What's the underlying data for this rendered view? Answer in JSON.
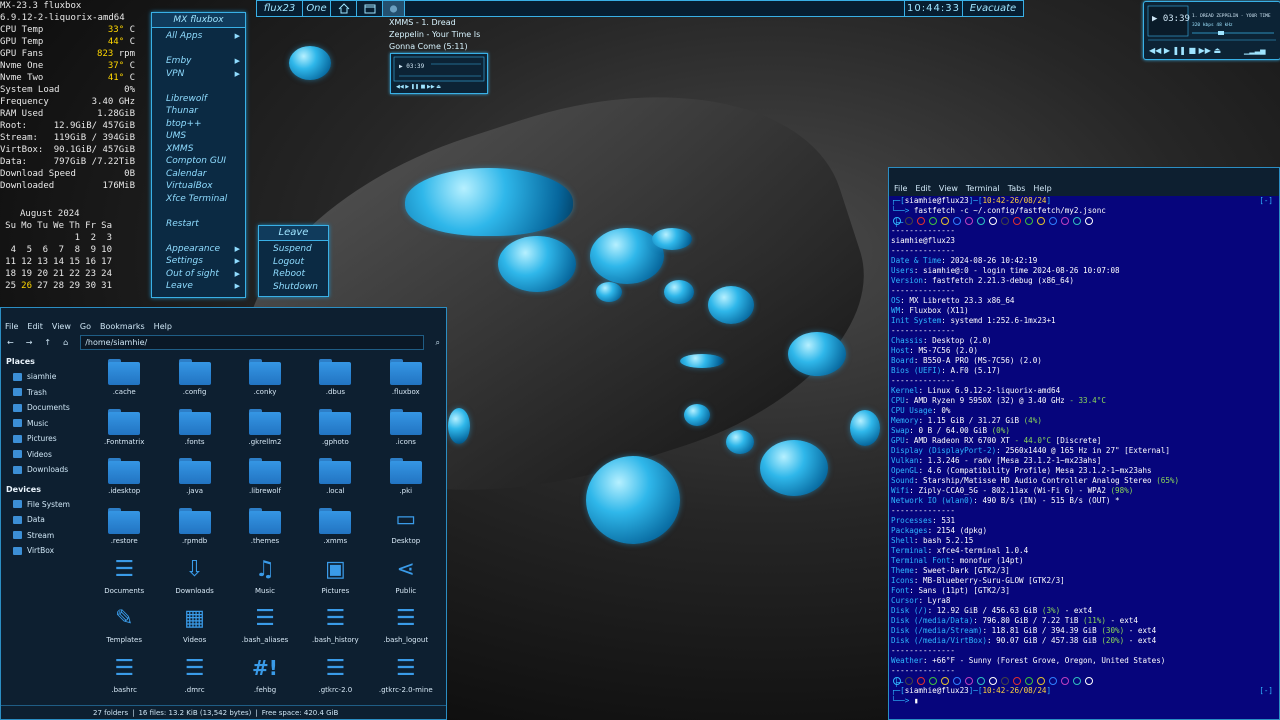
{
  "conky": {
    "title": "MX-23.3 fluxbox",
    "kernel": "6.9.12-2-liquorix-amd64",
    "rows": [
      {
        "label": "CPU Temp",
        "value": "33°",
        "unit": " C",
        "hl": true
      },
      {
        "label": "GPU Temp",
        "value": "44°",
        "unit": " C",
        "hl": true
      },
      {
        "label": "GPU Fans",
        "value": "823",
        "unit": " rpm",
        "hl": true
      },
      {
        "label": "Nvme One",
        "value": "37°",
        "unit": " C",
        "hl": true
      },
      {
        "label": "Nvme Two",
        "value": "41°",
        "unit": " C",
        "hl": true
      },
      {
        "label": "System Load",
        "value": "0%",
        "unit": "",
        "hl": false
      },
      {
        "label": "Frequency",
        "value": "3.40 GHz",
        "unit": "",
        "hl": false
      },
      {
        "label": "RAM Used",
        "value": "1.28GiB",
        "unit": "",
        "hl": false
      },
      {
        "label": "Root:",
        "value": "12.9GiB/ 457GiB",
        "unit": "",
        "hl": false
      },
      {
        "label": "Stream:",
        "value": "119GiB / 394GiB",
        "unit": "",
        "hl": false
      },
      {
        "label": "VirtBox:",
        "value": "90.1GiB/ 457GiB",
        "unit": "",
        "hl": false
      },
      {
        "label": "Data:",
        "value": "797GiB /7.22TiB",
        "unit": "",
        "hl": false
      },
      {
        "label": "Download Speed",
        "value": "0B",
        "unit": "",
        "hl": false
      },
      {
        "label": "Downloaded",
        "value": "176MiB",
        "unit": "",
        "hl": false
      }
    ],
    "calendar": {
      "month": "August 2024",
      "days_header": [
        "Su",
        "Mo",
        "Tu",
        "We",
        "Th",
        "Fr",
        "Sa"
      ],
      "weeks": [
        [
          "",
          "",
          "",
          "",
          "1",
          "2",
          "3"
        ],
        [
          "4",
          "5",
          "6",
          "7",
          "8",
          "9",
          "10"
        ],
        [
          "11",
          "12",
          "13",
          "14",
          "15",
          "16",
          "17"
        ],
        [
          "18",
          "19",
          "20",
          "21",
          "22",
          "23",
          "24"
        ],
        [
          "25",
          "26",
          "27",
          "28",
          "29",
          "30",
          "31"
        ]
      ],
      "today": "26"
    }
  },
  "fluxbox_menu": {
    "title": "MX fluxbox",
    "items": [
      {
        "label": "All Apps",
        "sub": true
      },
      {
        "sep": true
      },
      {
        "label": "Emby",
        "sub": true
      },
      {
        "label": "VPN",
        "sub": true
      },
      {
        "sep": true
      },
      {
        "label": "Librewolf"
      },
      {
        "label": "Thunar"
      },
      {
        "label": "btop++"
      },
      {
        "label": "UMS"
      },
      {
        "label": "XMMS"
      },
      {
        "label": "Compton GUI"
      },
      {
        "label": "Calendar"
      },
      {
        "label": "VirtualBox"
      },
      {
        "label": "Xfce Terminal"
      },
      {
        "sep": true
      },
      {
        "label": "Restart"
      },
      {
        "sep": true
      },
      {
        "label": "Appearance",
        "sub": true
      },
      {
        "label": "Settings",
        "sub": true
      },
      {
        "label": "Out of sight",
        "sub": true
      },
      {
        "label": "Leave",
        "sub": true
      }
    ]
  },
  "leave_menu": {
    "title": "Leave",
    "items": [
      "Suspend",
      "Logout",
      "Reboot",
      "Shutdown"
    ]
  },
  "toolbar": {
    "workspace_name": "flux23",
    "workspace": "One",
    "clock": "10:44:33",
    "right_button": "Evacuate"
  },
  "xmms_tooltip": "XMMS - 1. Dread Zeppelin - Your Time Is Gonna Come (5:11)",
  "xmms_player": {
    "time": "03:39",
    "title": "1. DREAD ZEPPELIN - YOUR TIME",
    "kbps": "320",
    "khz": "48"
  },
  "file_manager": {
    "menu": [
      "File",
      "Edit",
      "View",
      "Go",
      "Bookmarks",
      "Help"
    ],
    "path": "/home/siamhie/",
    "places_header": "Places",
    "places": [
      "siamhie",
      "Trash",
      "Documents",
      "Music",
      "Pictures",
      "Videos",
      "Downloads"
    ],
    "devices_header": "Devices",
    "devices": [
      "File System",
      "Data",
      "Stream",
      "VirtBox"
    ],
    "items": [
      {
        "name": ".cache",
        "type": "folder"
      },
      {
        "name": ".config",
        "type": "folder"
      },
      {
        "name": ".conky",
        "type": "folder"
      },
      {
        "name": ".dbus",
        "type": "folder"
      },
      {
        "name": ".fluxbox",
        "type": "folder"
      },
      {
        "name": ".Fontmatrix",
        "type": "folder"
      },
      {
        "name": ".fonts",
        "type": "folder"
      },
      {
        "name": ".gkrellm2",
        "type": "folder"
      },
      {
        "name": ".gphoto",
        "type": "folder"
      },
      {
        "name": ".icons",
        "type": "folder"
      },
      {
        "name": ".idesktop",
        "type": "folder"
      },
      {
        "name": ".java",
        "type": "folder"
      },
      {
        "name": ".librewolf",
        "type": "folder"
      },
      {
        "name": ".local",
        "type": "folder"
      },
      {
        "name": ".pki",
        "type": "folder"
      },
      {
        "name": ".restore",
        "type": "folder"
      },
      {
        "name": ".rpmdb",
        "type": "folder"
      },
      {
        "name": ".themes",
        "type": "folder"
      },
      {
        "name": ".xmms",
        "type": "folder"
      },
      {
        "name": "Desktop",
        "type": "desktop"
      },
      {
        "name": "Documents",
        "type": "doc"
      },
      {
        "name": "Downloads",
        "type": "download"
      },
      {
        "name": "Music",
        "type": "music"
      },
      {
        "name": "Pictures",
        "type": "picture"
      },
      {
        "name": "Public",
        "type": "share"
      },
      {
        "name": "Templates",
        "type": "template"
      },
      {
        "name": "Videos",
        "type": "video"
      },
      {
        "name": ".bash_aliases",
        "type": "file"
      },
      {
        "name": ".bash_history",
        "type": "file"
      },
      {
        "name": ".bash_logout",
        "type": "file"
      },
      {
        "name": ".bashrc",
        "type": "file"
      },
      {
        "name": ".dmrc",
        "type": "file"
      },
      {
        "name": ".fehbg",
        "type": "script"
      },
      {
        "name": ".gtkrc-2.0",
        "type": "file"
      },
      {
        "name": ".gtkrc-2.0-mine",
        "type": "file"
      }
    ],
    "status_folders": "27 folders",
    "status_files": "16 files: 13.2 KiB (13,542 bytes)",
    "status_free": "Free space: 420.4 GiB"
  },
  "terminal": {
    "menu": [
      "File",
      "Edit",
      "View",
      "Terminal",
      "Tabs",
      "Help"
    ],
    "prompt_user": "siamhie@flux23",
    "prompt_time": "10:42-26/08/24",
    "prompt_time_end": "10:42-26/08/24",
    "command": "fastfetch -c ~/.config/fastfetch/my2.jsonc",
    "header": "siamhie@flux23",
    "sections": [
      [
        [
          "Date & Time",
          "2024-08-26 10:42:19"
        ],
        [
          "Users",
          "siamhie@:0 - login time 2024-08-26 10:07:08"
        ],
        [
          "Version",
          "fastfetch 2.21.3-debug (x86_64)"
        ]
      ],
      [
        [
          "OS",
          "MX Libretto 23.3 x86_64"
        ],
        [
          "WM",
          "Fluxbox (X11)"
        ],
        [
          "Init System",
          "systemd 1:252.6-1mx23+1"
        ]
      ],
      [
        [
          "Chassis",
          "Desktop (2.0)"
        ],
        [
          "Host",
          "MS-7C56 (2.0)"
        ],
        [
          "Board",
          "B550-A PRO (MS-7C56) (2.0)"
        ],
        [
          "Bios (UEFI)",
          "A.F0 (5.17)"
        ]
      ],
      [
        [
          "Kernel",
          "Linux 6.9.12-2-liquorix-amd64"
        ],
        [
          "CPU",
          "AMD Ryzen 9 5950X (32) @ 3.40 GHz - 33.4°C"
        ],
        [
          "CPU Usage",
          "0%"
        ],
        [
          "Memory",
          "1.15 GiB / 31.27 GiB (4%)"
        ],
        [
          "Swap",
          "0 B / 64.00 GiB (0%)"
        ],
        [
          "GPU",
          "AMD Radeon RX 6700 XT - 44.0°C [Discrete]"
        ],
        [
          "Display (DisplayPort-2)",
          "2560x1440 @ 165 Hz in 27\" [External]"
        ],
        [
          "Vulkan",
          "1.3.246 - radv [Mesa 23.1.2-1~mx23ahs]"
        ],
        [
          "OpenGL",
          "4.6 (Compatibility Profile) Mesa 23.1.2-1~mx23ahs"
        ],
        [
          "Sound",
          "Starship/Matisse HD Audio Controller Analog Stereo (65%)"
        ],
        [
          "Wifi",
          "Ziply-CCA0_5G - 802.11ax (Wi-Fi 6) - WPA2 (98%)"
        ],
        [
          "Network IO (wlan0)",
          "490 B/s (IN) - 515 B/s (OUT) *"
        ]
      ],
      [
        [
          "Processes",
          "531"
        ],
        [
          "Packages",
          "2154 (dpkg)"
        ],
        [
          "Shell",
          "bash 5.2.15"
        ],
        [
          "Terminal",
          "xfce4-terminal 1.0.4"
        ],
        [
          "Terminal Font",
          "monofur (14pt)"
        ],
        [
          "Theme",
          "Sweet-Dark [GTK2/3]"
        ],
        [
          "Icons",
          "MB-Blueberry-Suru-GLOW [GTK2/3]"
        ],
        [
          "Font",
          "Sans (11pt) [GTK2/3]"
        ],
        [
          "Cursor",
          "Lyra8"
        ],
        [
          "Disk (/)",
          "12.92 GiB / 456.63 GiB (3%) - ext4"
        ],
        [
          "Disk (/media/Data)",
          "796.80 GiB / 7.22 TiB (11%) - ext4"
        ],
        [
          "Disk (/media/Stream)",
          "118.81 GiB / 394.39 GiB (30%) - ext4"
        ],
        [
          "Disk (/media/VirtBox)",
          "90.07 GiB / 457.38 GiB (20%) - ext4"
        ]
      ],
      [
        [
          "Weather",
          "+66°F - Sunny (Forest Grove, Oregon, United States)"
        ]
      ]
    ],
    "separator": "--------------",
    "color_dots": [
      "#444444",
      "#e03030",
      "#40c040",
      "#e0c030",
      "#3080ff",
      "#c040c0",
      "#30c0c0",
      "#ffffff"
    ]
  }
}
